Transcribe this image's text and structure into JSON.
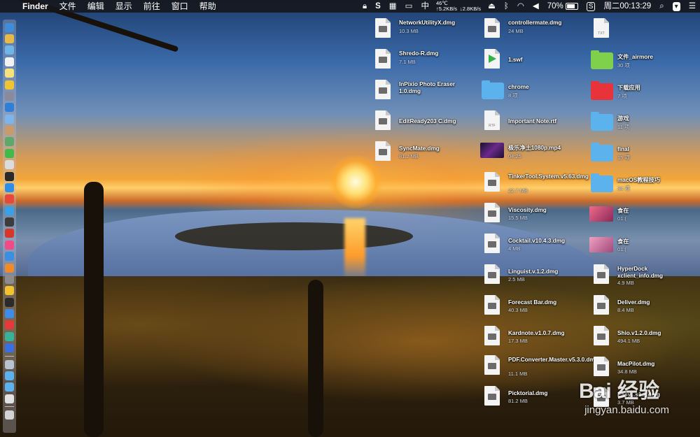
{
  "menubar": {
    "app_name": "Finder",
    "menus": [
      "文件",
      "编辑",
      "显示",
      "前往",
      "窗口",
      "帮助"
    ],
    "temp": "46℃",
    "net_up": "↑5.2KB/s",
    "net_down": "↓2.8KB/s",
    "input_method": "中",
    "battery_percent": "70%",
    "clock": "周二00:13:29"
  },
  "desktop": {
    "col1": [
      {
        "name": "NetworkUtilityX.dmg",
        "size": "10.3 MB",
        "kind": "dmg"
      },
      {
        "name": "Shredo-R.dmg",
        "size": "7.1 MB",
        "kind": "dmg"
      },
      {
        "name": "InPixio Photo Eraser 1.0.dmg",
        "size": "",
        "kind": "dmg"
      },
      {
        "name": "EditReady203 C.dmg",
        "size": "",
        "kind": "dmg"
      },
      {
        "name": "SyncMate.dmg",
        "size": "81.2 MB",
        "kind": "dmg"
      }
    ],
    "col2": [
      {
        "name": "controllermate.dmg",
        "size": "24 MB",
        "kind": "dmg"
      },
      {
        "name": "1.swf",
        "size": "",
        "kind": "swf"
      },
      {
        "name": "chrome",
        "size": "8 项",
        "kind": "folder"
      },
      {
        "name": "Important Note.rtf",
        "size": "",
        "kind": "rtf"
      },
      {
        "name": "极乐净土1080p.mp4",
        "size": "04:25",
        "kind": "video"
      },
      {
        "name": "TinkerTool.System.v5.63.dmg",
        "size": "22.7 MB",
        "kind": "dmg"
      },
      {
        "name": "Viscosity.dmg",
        "size": "15.5 MB",
        "kind": "dmg"
      },
      {
        "name": "Cocktail.v10.4.3.dmg",
        "size": "4 MB",
        "kind": "dmg"
      },
      {
        "name": "Linguist.v.1.2.dmg",
        "size": "2.5 MB",
        "kind": "dmg"
      },
      {
        "name": "Forecast Bar.dmg",
        "size": "40.3 MB",
        "kind": "dmg"
      },
      {
        "name": "Kardnote.v1.0.7.dmg",
        "size": "17.3 MB",
        "kind": "dmg"
      },
      {
        "name": "PDF.Converter.Master.v5.3.0.dmg",
        "size": "11.1 MB",
        "kind": "dmg"
      },
      {
        "name": "Picktorial.dmg",
        "size": "81.2 MB",
        "kind": "dmg"
      }
    ],
    "col3": [
      {
        "name": "",
        "size": "",
        "kind": "txt"
      },
      {
        "name": "文件_airmore",
        "size": "30 项",
        "kind": "folder-green"
      },
      {
        "name": "下载应用",
        "size": "7 项",
        "kind": "folder-red"
      },
      {
        "name": "游戏",
        "size": "11 项",
        "kind": "folder"
      },
      {
        "name": "final",
        "size": "15 项",
        "kind": "folder"
      },
      {
        "name": "macOS教程技巧",
        "size": "34 项",
        "kind": "folder"
      },
      {
        "name": "食在",
        "size": "01:(",
        "kind": "video2"
      },
      {
        "name": "食在",
        "size": "01:(",
        "kind": "video2"
      },
      {
        "name": "HyperDock xclient_info.dmg",
        "size": "4.9 MB",
        "kind": "dmg"
      },
      {
        "name": "Deliver.dmg",
        "size": "8.4 MB",
        "kind": "dmg"
      },
      {
        "name": "Shio.v1.2.0.dmg",
        "size": "494.1 MB",
        "kind": "dmg"
      },
      {
        "name": "MacPilot.dmg",
        "size": "34.8 MB",
        "kind": "dmg"
      },
      {
        "name": "Easy...s1.2.dmg",
        "size": "3.7 MB",
        "kind": "dmg"
      }
    ],
    "txt_tag": "TXT",
    "rtf_tag": "RTF"
  },
  "watermark": {
    "brand": "Bai 经验",
    "url": "jingyan.baidu.com"
  },
  "colors": {
    "folder_blue": "#5bb2ec",
    "folder_green": "#7fd04a",
    "folder_red": "#e8333a"
  }
}
